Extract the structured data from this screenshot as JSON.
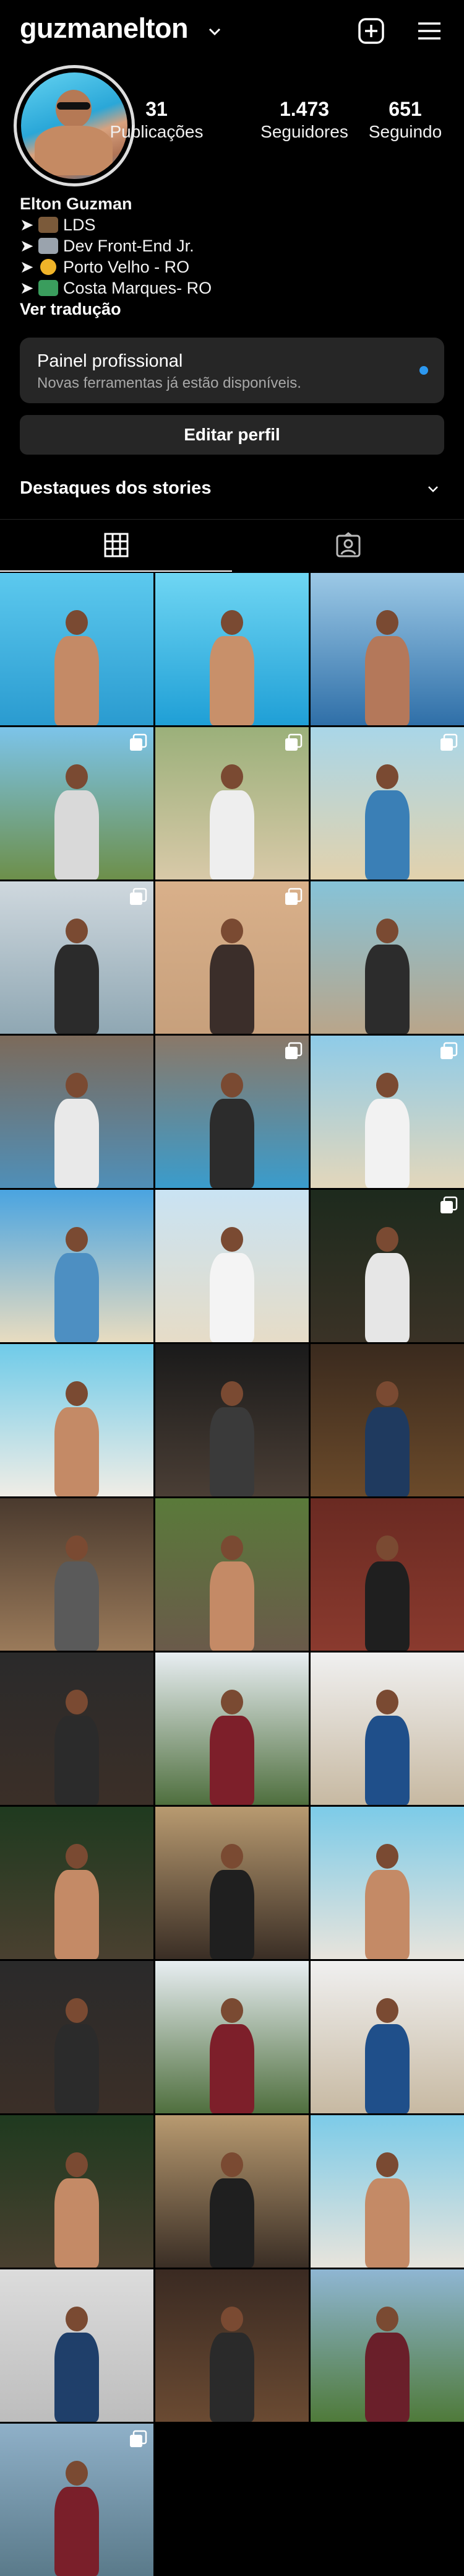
{
  "header": {
    "username": "guzmanelton"
  },
  "profile": {
    "stats": [
      {
        "count": "31",
        "label": "Publicações"
      },
      {
        "count": "1.473",
        "label": "Seguidores"
      },
      {
        "count": "651",
        "label": "Seguindo"
      }
    ],
    "bio": {
      "name": "Elton Guzman",
      "lines": [
        {
          "arrow": "➤",
          "text": "LDS",
          "emoji_color": "#7b5a3a"
        },
        {
          "arrow": "➤",
          "text": "Dev Front-End Jr.",
          "emoji_color": "#9aa3ad"
        },
        {
          "arrow": "➤",
          "text": "Porto Velho - RO",
          "emoji_color": "#f0b429"
        },
        {
          "arrow": "➤",
          "text": "Costa Marques- RO",
          "emoji_color": "#3a9d5d"
        }
      ],
      "see_translation": "Ver tradução"
    }
  },
  "professional_panel": {
    "title": "Painel profissional",
    "subtitle": "Novas ferramentas já estão disponíveis.",
    "dot_color": "#2c98f0"
  },
  "edit_profile": "Editar perfil",
  "highlights": {
    "label": "Destaques dos stories"
  },
  "tabs": [
    {
      "icon": "grid-icon",
      "active": true
    },
    {
      "icon": "tagged-icon",
      "active": false
    }
  ],
  "posts": [
    {
      "bg": [
        "#5cc9ee",
        "#2a9bd0"
      ],
      "multi": false,
      "fig": "#c48a66"
    },
    {
      "bg": [
        "#6fd6f3",
        "#1f9fd6"
      ],
      "multi": false,
      "fig": "#c8906a"
    },
    {
      "bg": [
        "#9cc9e6",
        "#2f6fa8"
      ],
      "multi": false,
      "fig": "#b4785a"
    },
    {
      "bg": [
        "#7cc4ea",
        "#6d8f4a"
      ],
      "multi": true,
      "fig": "#d9d9d9"
    },
    {
      "bg": [
        "#9bb07a",
        "#d8c9a8"
      ],
      "multi": true,
      "fig": "#eeeeee"
    },
    {
      "bg": [
        "#a9d6e8",
        "#e2d2ad"
      ],
      "multi": true,
      "fig": "#3a7fb6"
    },
    {
      "bg": [
        "#cfd8de",
        "#8fa7b3"
      ],
      "multi": true,
      "fig": "#2b2b2b"
    },
    {
      "bg": [
        "#d9b08a",
        "#c7a07c"
      ],
      "multi": true,
      "fig": "#3b2e2a"
    },
    {
      "bg": [
        "#86c3d8",
        "#b9a58a"
      ],
      "multi": false,
      "fig": "#2c2c2c"
    },
    {
      "bg": [
        "#7c6a5a",
        "#4f8fb8"
      ],
      "multi": false,
      "fig": "#e9e9e9"
    },
    {
      "bg": [
        "#8a7868",
        "#3a9ccc"
      ],
      "multi": true,
      "fig": "#2c2c2c"
    },
    {
      "bg": [
        "#8ecbe8",
        "#e3d7bb"
      ],
      "multi": true,
      "fig": "#f2f2f2"
    },
    {
      "bg": [
        "#4aa4e0",
        "#e8dcc0"
      ],
      "multi": false,
      "fig": "#4d8fc2"
    },
    {
      "bg": [
        "#c9e3f3",
        "#e6dcc7"
      ],
      "multi": false,
      "fig": "#f4f4f4"
    },
    {
      "bg": [
        "#1d2a1d",
        "#3a3226"
      ],
      "multi": true,
      "fig": "#e6e6e6"
    },
    {
      "bg": [
        "#6fcbe9",
        "#f0ede6"
      ],
      "multi": false,
      "fig": "#c48a66"
    },
    {
      "bg": [
        "#1a1a1a",
        "#4a3e35"
      ],
      "multi": false,
      "fig": "#3a3a3a"
    },
    {
      "bg": [
        "#3a2a1e",
        "#6b4a2a"
      ],
      "multi": false,
      "fig": "#1f3a5f"
    },
    {
      "bg": [
        "#4a3a2e",
        "#9a7a5a"
      ],
      "multi": false,
      "fig": "#5a5a5a"
    },
    {
      "bg": [
        "#5a7a3a",
        "#6a5a4a"
      ],
      "multi": false,
      "fig": "#c48a66"
    },
    {
      "bg": [
        "#6a2a22",
        "#8a3a2e"
      ],
      "multi": false,
      "fig": "#1f1f1f"
    },
    {
      "bg": [
        "#2a2a2a",
        "#3b2f28"
      ],
      "multi": false,
      "fig": "#2b2b2b"
    },
    {
      "bg": [
        "#e8eef2",
        "#4f6f3e"
      ],
      "multi": false,
      "fig": "#7d1f2a"
    },
    {
      "bg": [
        "#f0f0f0",
        "#c7b9a2"
      ],
      "multi": false,
      "fig": "#1f4f8a"
    },
    {
      "bg": [
        "#1f3a1f",
        "#4a4030"
      ],
      "multi": false,
      "fig": "#c48a66"
    },
    {
      "bg": [
        "#b89a70",
        "#3a2e25"
      ],
      "multi": false,
      "fig": "#1f1f1f"
    },
    {
      "bg": [
        "#7ccbe8",
        "#e8e4dc"
      ],
      "multi": false,
      "fig": "#c48a66"
    },
    {
      "bg": [
        "#2a2a2a",
        "#3b2f28"
      ],
      "multi": false,
      "fig": "#2b2b2b"
    },
    {
      "bg": [
        "#e8eef2",
        "#4f6f3e"
      ],
      "multi": false,
      "fig": "#7d1f2a"
    },
    {
      "bg": [
        "#f0f0f0",
        "#c7b9a2"
      ],
      "multi": false,
      "fig": "#1f4f8a"
    },
    {
      "bg": [
        "#1f3a1f",
        "#4a4030"
      ],
      "multi": false,
      "fig": "#c48a66"
    },
    {
      "bg": [
        "#b89a70",
        "#3a2e25"
      ],
      "multi": false,
      "fig": "#1f1f1f"
    },
    {
      "bg": [
        "#7ccbe8",
        "#e8e4dc"
      ],
      "multi": false,
      "fig": "#c48a66"
    },
    {
      "bg": [
        "#dcdcdc",
        "#bdbdbd"
      ],
      "multi": false,
      "fig": "#1f3f6a"
    },
    {
      "bg": [
        "#3a2a22",
        "#6a4a32"
      ],
      "multi": false,
      "fig": "#2a2a2a"
    },
    {
      "bg": [
        "#8fb6d3",
        "#4f7a3a"
      ],
      "multi": false,
      "fig": "#6a1f2a"
    },
    {
      "bg": [
        "#8fb0c8",
        "#5a7a8a"
      ],
      "multi": true,
      "fig": "#7a1f2a"
    }
  ]
}
